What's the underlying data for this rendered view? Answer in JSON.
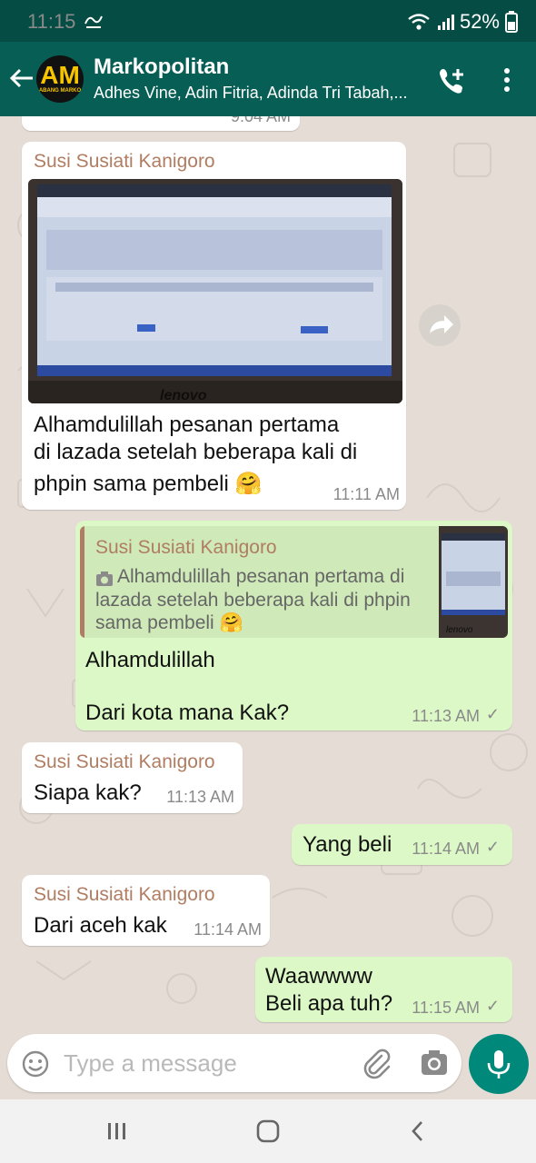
{
  "status_bar": {
    "time": "11:15",
    "battery": "52%",
    "icons": [
      "notification-icon",
      "wifi-icon",
      "signal-icon",
      "battery-icon"
    ]
  },
  "header": {
    "title": "Markopolitan",
    "members": "Adhes Vine, Adin Fitria, Adinda Tri Tabah,...",
    "avatar_text": "AM",
    "avatar_caption": "ABANG MARKO"
  },
  "chat": {
    "partial_time": "9:04 AM",
    "messages": [
      {
        "direction": "in",
        "sender": "Susi Susiati Kanigoro",
        "line1": "Alhamdulillah pesanan pertama",
        "line2": "di lazada setelah beberapa kali di",
        "line3": "phpin sama pembeli 🤗",
        "time": "11:11 AM",
        "has_image": true
      },
      {
        "direction": "out",
        "reply_sender": "Susi Susiati Kanigoro",
        "reply_line1": "Alhamdulillah pesanan pertama di",
        "reply_line2": "lazada setelah beberapa kali di phpin",
        "reply_line3": "sama pembeli 🤗",
        "line1": "Alhamdulillah",
        "line2": "Dari kota mana Kak?",
        "time": "11:13 AM",
        "status": "✓"
      },
      {
        "direction": "in",
        "sender": "Susi Susiati Kanigoro",
        "text": "Siapa kak?",
        "time": "11:13 AM"
      },
      {
        "direction": "out",
        "text": "Yang beli",
        "time": "11:14 AM",
        "status": "✓"
      },
      {
        "direction": "in",
        "sender": "Susi Susiati Kanigoro",
        "text": "Dari aceh kak",
        "time": "11:14 AM"
      },
      {
        "direction": "out",
        "line1": "Waawwww",
        "line2": "Beli apa tuh?",
        "time": "11:15 AM",
        "status": "✓"
      }
    ]
  },
  "composer": {
    "placeholder": "Type a message"
  },
  "colors": {
    "header": "#075e54",
    "statusbar": "#054d44",
    "incoming": "#ffffff",
    "outgoing": "#dcf8c6",
    "mic": "#00897b",
    "sender": "#b07d62"
  }
}
